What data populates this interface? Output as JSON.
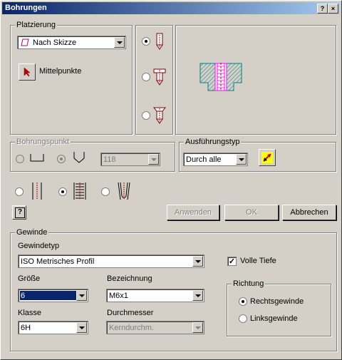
{
  "window": {
    "title": "Bohrungen",
    "help_btn": "?",
    "close_btn": "×"
  },
  "platzierung": {
    "legend": "Platzierung",
    "dropdown_value": "Nach Skizze",
    "mittelpunkte_label": "Mittelpunkte"
  },
  "bohrungspunkt": {
    "legend": "Bohrungspunkt",
    "angle_value": "118"
  },
  "ausfuehrungstyp": {
    "legend": "Ausführungstyp",
    "value": "Durch alle"
  },
  "buttons": {
    "help": "?",
    "apply": "Anwenden",
    "ok": "OK",
    "cancel": "Abbrechen"
  },
  "gewinde": {
    "legend": "Gewinde",
    "typ_label": "Gewindetyp",
    "typ_value": "ISO Metrisches Profil",
    "volle_tiefe_label": "Volle Tiefe",
    "groesse_label": "Größe",
    "groesse_value": "6",
    "bezeichnung_label": "Bezeichnung",
    "bezeichnung_value": "M6x1",
    "klasse_label": "Klasse",
    "klasse_value": "6H",
    "durchmesser_label": "Durchmesser",
    "durchmesser_value": "Kerndurchm.",
    "richtung": {
      "legend": "Richtung",
      "rechts": "Rechtsgewinde",
      "links": "Linksgewinde"
    }
  },
  "colors": {
    "title_start": "#0a246a",
    "title_end": "#a6caf0",
    "selection": "#0a246a",
    "preview_hatch": "#008080",
    "preview_thread": "#ff00ff"
  }
}
